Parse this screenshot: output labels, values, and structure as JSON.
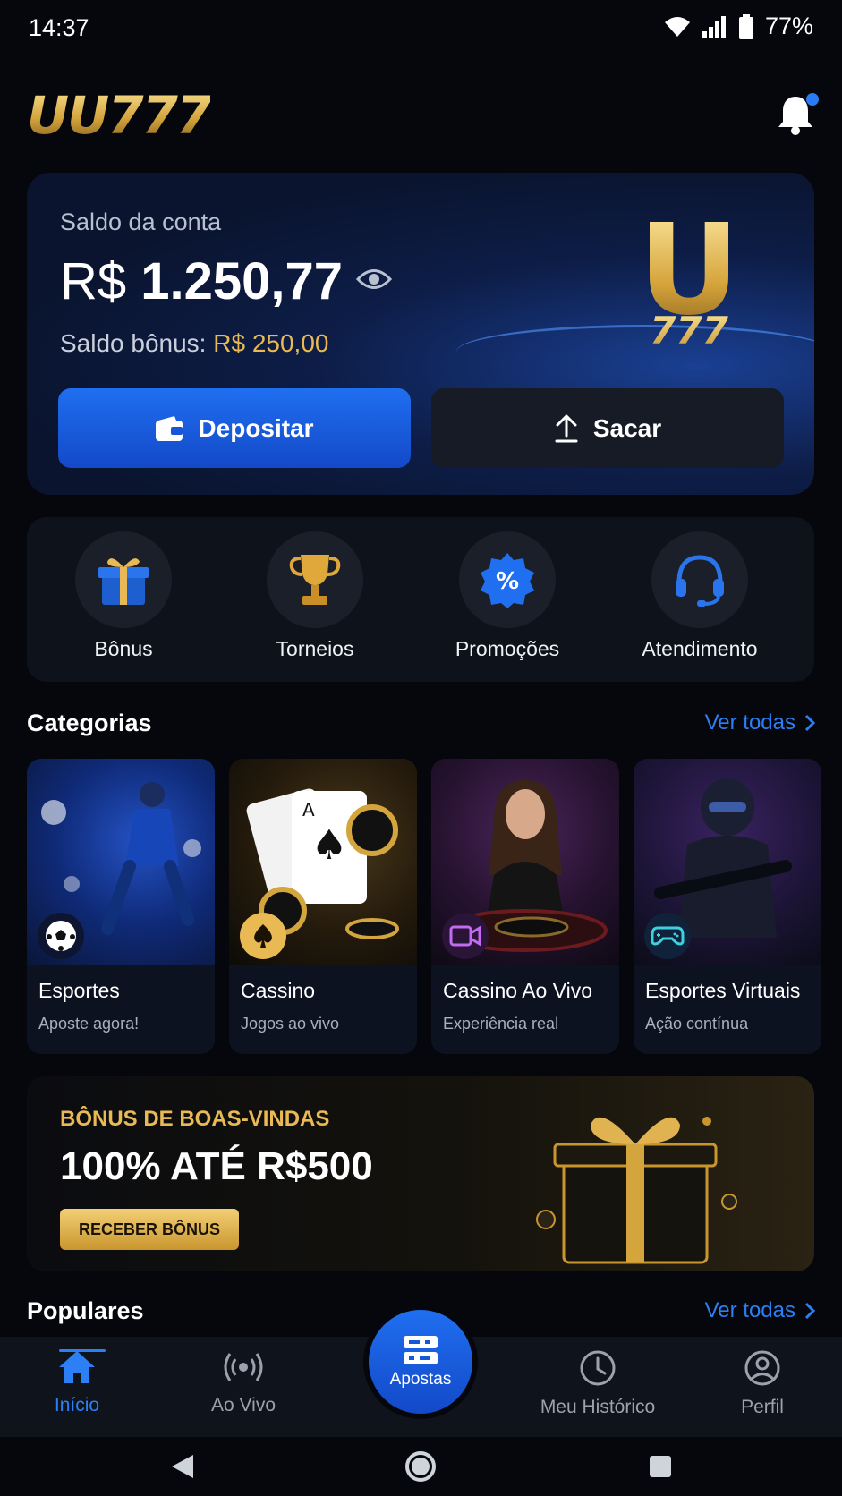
{
  "status_bar": {
    "time": "14:37",
    "battery": "77%"
  },
  "header": {
    "logo": "UU777"
  },
  "balance_card": {
    "label": "Saldo da conta",
    "currency": "R$",
    "amount": "1.250,77",
    "bonus_label": "Saldo bônus:",
    "bonus_amount": "R$ 250,00",
    "card_logo_u": "U",
    "card_logo_777": "777",
    "deposit_label": "Depositar",
    "withdraw_label": "Sacar"
  },
  "quick_actions": [
    {
      "label": "Bônus",
      "icon": "gift-icon"
    },
    {
      "label": "Torneios",
      "icon": "trophy-icon"
    },
    {
      "label": "Promoções",
      "icon": "percent-badge-icon"
    },
    {
      "label": "Atendimento",
      "icon": "headset-icon"
    }
  ],
  "categories_section": {
    "title": "Categorias",
    "see_all": "Ver todas",
    "items": [
      {
        "name": "Esportes",
        "subtitle": "Aposte agora!",
        "icon": "soccer-ball-icon"
      },
      {
        "name": "Cassino",
        "subtitle": "Jogos ao vivo",
        "icon": "spade-icon"
      },
      {
        "name": "Cassino Ao Vivo",
        "subtitle": "Experiência real",
        "icon": "video-camera-icon"
      },
      {
        "name": "Esportes Virtuais",
        "subtitle": "Ação contínua",
        "icon": "gamepad-icon"
      }
    ]
  },
  "promo_banner": {
    "kicker": "BÔNUS DE BOAS-VINDAS",
    "title": "100% ATÉ R$500",
    "button": "RECEBER BÔNUS"
  },
  "popular_section": {
    "title": "Populares",
    "see_all": "Ver todas"
  },
  "bottom_nav": {
    "items": [
      {
        "label": "Início",
        "icon": "home-icon",
        "active": true
      },
      {
        "label": "Ao Vivo",
        "icon": "live-broadcast-icon",
        "active": false
      },
      {
        "label": "Apostas",
        "icon": "ticket-icon",
        "active": false
      },
      {
        "label": "Meu Histórico",
        "icon": "clock-icon",
        "active": false
      },
      {
        "label": "Perfil",
        "icon": "user-icon",
        "active": false
      }
    ]
  },
  "colors": {
    "accent_blue": "#1f6ff0",
    "gold": "#e9b954",
    "background": "#05070d"
  }
}
